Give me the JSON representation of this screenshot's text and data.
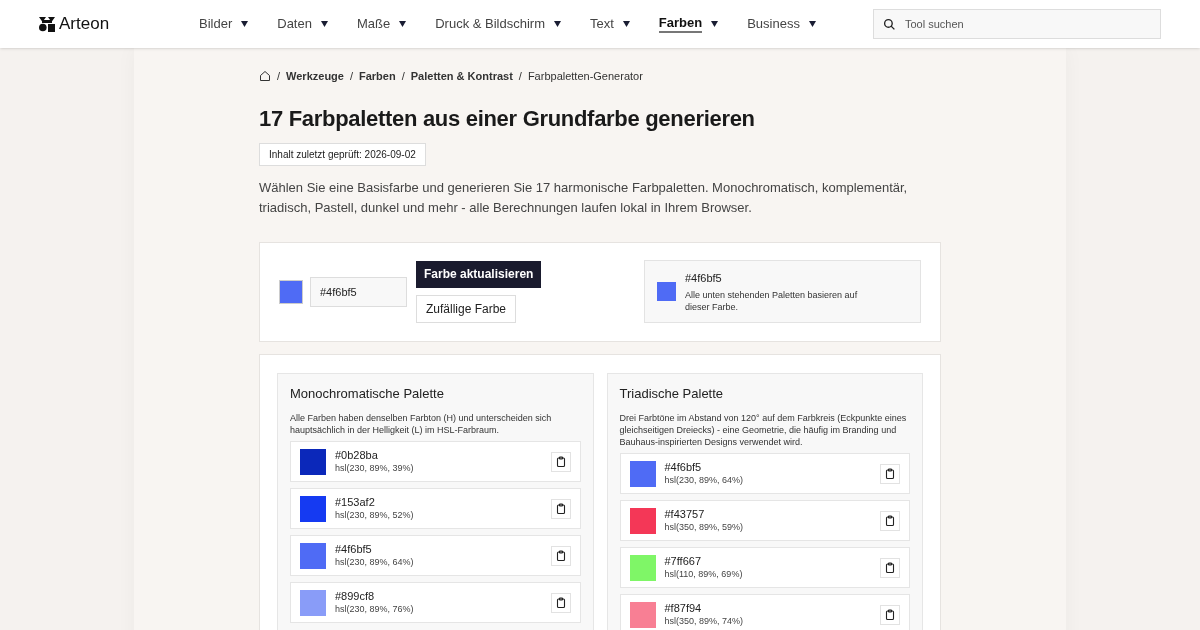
{
  "logo": "Arteon",
  "nav": [
    {
      "label": "Bilder",
      "selected": false
    },
    {
      "label": "Daten",
      "selected": false
    },
    {
      "label": "Maße",
      "selected": false
    },
    {
      "label": "Druck & Bildschirm",
      "selected": false
    },
    {
      "label": "Text",
      "selected": false
    },
    {
      "label": "Farben",
      "selected": true
    },
    {
      "label": "Business",
      "selected": false
    }
  ],
  "search": {
    "placeholder": "Tool suchen"
  },
  "breadcrumb_separator": "/",
  "breadcrumb": [
    "Werkzeuge",
    "Farben",
    "Paletten & Kontrast",
    "Farbpaletten-Generator"
  ],
  "title": "17 Farbpaletten aus einer Grundfarbe generieren",
  "checked_badge": "Inhalt zuletzt geprüft: 2026-09-02",
  "intro": "Wählen Sie eine Basisfarbe und generieren Sie 17 harmonische Farbpaletten. Monochromatisch, komplementär, triadisch, Pastell, dunkel und mehr - alle Berechnungen laufen lokal in Ihrem Browser.",
  "picker": {
    "color": "#4f6bf5",
    "value": "#4f6bf5",
    "update_button": "Farbe aktualisieren",
    "random_button": "Zufällige Farbe"
  },
  "base_info": {
    "color": "#4f6bf5",
    "hex": "#4f6bf5",
    "note": "Alle unten stehenden Paletten basieren auf dieser Farbe."
  },
  "palettes": [
    {
      "title": "Monochromatische Palette",
      "description": "Alle Farben haben denselben Farbton (H) und unterscheiden sich hauptsächlich in der Helligkeit (L) im HSL-Farbraum.",
      "colors": [
        {
          "color": "#0b28ba",
          "hex": "#0b28ba",
          "hsl": "hsl(230, 89%, 39%)"
        },
        {
          "color": "#153af2",
          "hex": "#153af2",
          "hsl": "hsl(230, 89%, 52%)"
        },
        {
          "color": "#4f6bf5",
          "hex": "#4f6bf5",
          "hsl": "hsl(230, 89%, 64%)"
        },
        {
          "color": "#899cf8",
          "hex": "#899cf8",
          "hsl": "hsl(230, 89%, 76%)"
        }
      ]
    },
    {
      "title": "Triadische Palette",
      "description": "Drei Farbtöne im Abstand von 120° auf dem Farbkreis (Eckpunkte eines gleichseitigen Dreiecks) - eine Geometrie, die häufig im Branding und Bauhaus-inspirierten Designs verwendet wird.",
      "colors": [
        {
          "color": "#4f6bf5",
          "hex": "#4f6bf5",
          "hsl": "hsl(230, 89%, 64%)"
        },
        {
          "color": "#f43757",
          "hex": "#f43757",
          "hsl": "hsl(350, 89%, 59%)"
        },
        {
          "color": "#7ff667",
          "hex": "#7ff667",
          "hsl": "hsl(110, 89%, 69%)"
        },
        {
          "color": "#f87f94",
          "hex": "#f87f94",
          "hsl": "hsl(350, 89%, 74%)"
        }
      ]
    }
  ]
}
